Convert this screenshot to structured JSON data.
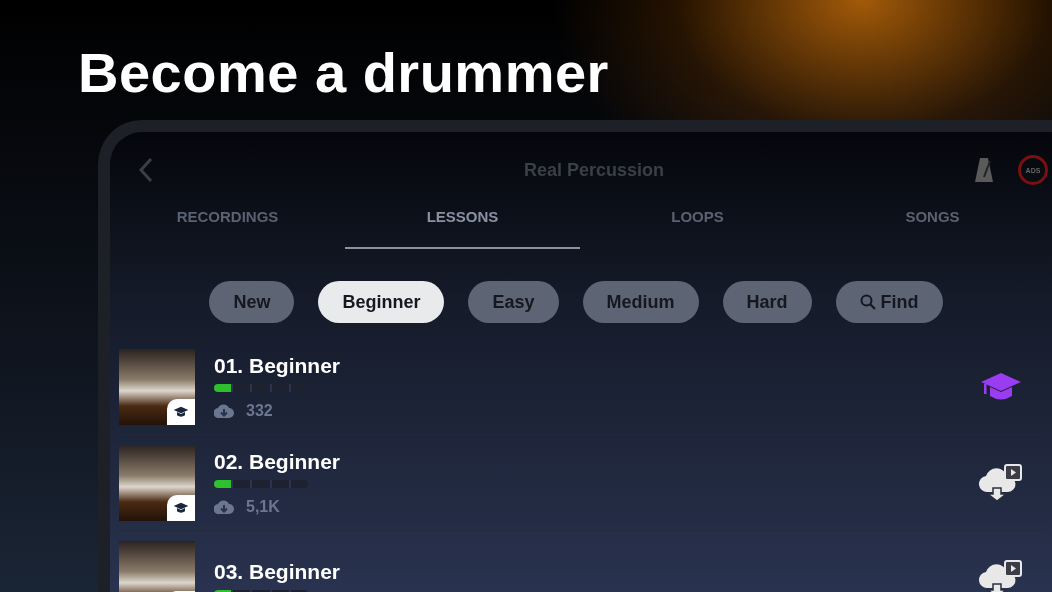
{
  "headline": "Become a drummer",
  "app_bar": {
    "title": "Real Percussion",
    "ads_badge": "ADS"
  },
  "tabs": [
    {
      "label": "RECORDINGS",
      "selected": false
    },
    {
      "label": "LESSONS",
      "selected": true
    },
    {
      "label": "LOOPS",
      "selected": false
    },
    {
      "label": "SONGS",
      "selected": false
    }
  ],
  "filters": [
    {
      "label": "New",
      "selected": false,
      "kind": "filter"
    },
    {
      "label": "Beginner",
      "selected": true,
      "kind": "filter"
    },
    {
      "label": "Easy",
      "selected": false,
      "kind": "filter"
    },
    {
      "label": "Medium",
      "selected": false,
      "kind": "filter"
    },
    {
      "label": "Hard",
      "selected": false,
      "kind": "filter"
    },
    {
      "label": "Find",
      "selected": false,
      "kind": "search"
    }
  ],
  "lessons": [
    {
      "title": "01. Beginner",
      "level": 0.2,
      "downloads": "332",
      "kind": "lesson"
    },
    {
      "title": "02. Beginner",
      "level": 0.2,
      "downloads": "5,1K",
      "kind": "download"
    },
    {
      "title": "03. Beginner",
      "level": 0.2,
      "kind": "download"
    }
  ]
}
